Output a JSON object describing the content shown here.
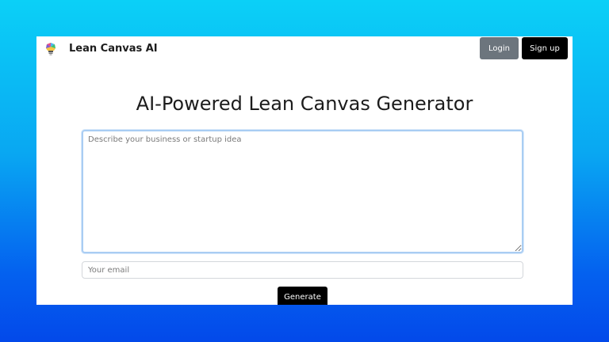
{
  "navbar": {
    "brand": "Lean Canvas AI",
    "logo_icon": "lightbulb-icon",
    "login_label": "Login",
    "signup_label": "Sign up"
  },
  "main": {
    "title": "AI-Powered Lean Canvas Generator",
    "idea_placeholder": "Describe your business or startup idea",
    "email_placeholder": "Your email",
    "generate_label": "Generate"
  },
  "colors": {
    "background_top": "#0bd0f7",
    "background_bottom": "#0349ea",
    "login_button": "#6c757d",
    "primary_button": "#000000",
    "focus_border": "#a9cdf3"
  }
}
